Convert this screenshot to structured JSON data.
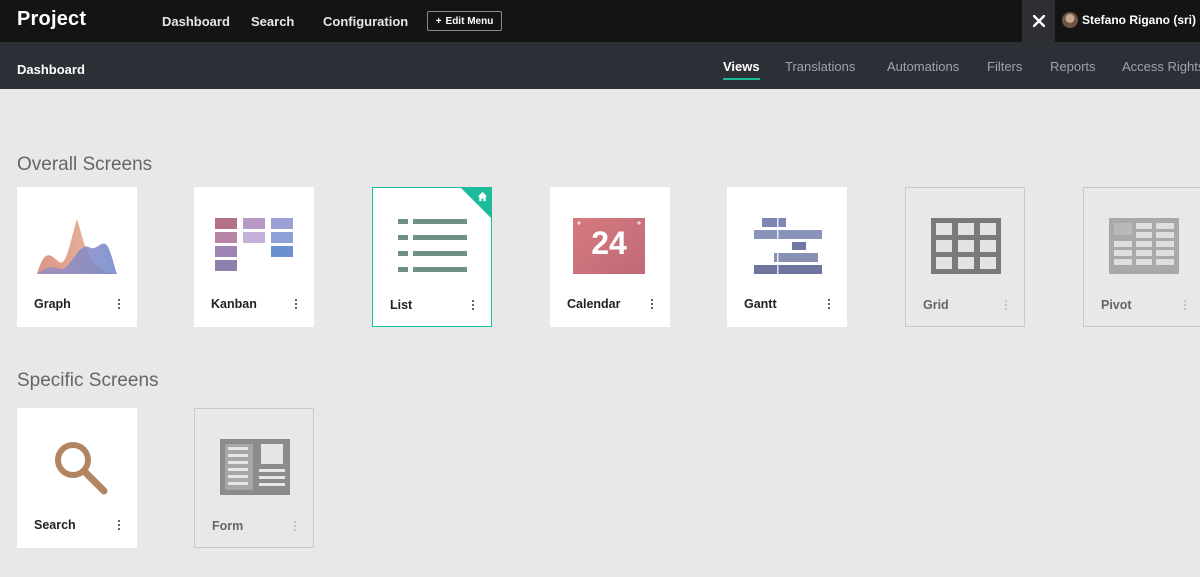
{
  "app": {
    "brand": "Project",
    "nav": [
      "Dashboard",
      "Search",
      "Configuration"
    ],
    "edit_menu": "Edit Menu",
    "user_name": "Stefano Rigano (sri)"
  },
  "subnav": {
    "title": "Dashboard",
    "tabs": [
      {
        "label": "Views",
        "active": true
      },
      {
        "label": "Translations",
        "active": false
      },
      {
        "label": "Automations",
        "active": false
      },
      {
        "label": "Filters",
        "active": false
      },
      {
        "label": "Reports",
        "active": false
      },
      {
        "label": "Access Rights",
        "active": false
      }
    ]
  },
  "sections": {
    "overall_title": "Overall Screens",
    "specific_title": "Specific Screens"
  },
  "overall_cards": [
    {
      "label": "Graph",
      "icon": "graph-icon",
      "enabled": true,
      "selected": false
    },
    {
      "label": "Kanban",
      "icon": "kanban-icon",
      "enabled": true,
      "selected": false
    },
    {
      "label": "List",
      "icon": "list-icon",
      "enabled": true,
      "selected": true,
      "default_icon": "home-icon"
    },
    {
      "label": "Calendar",
      "icon": "calendar-icon",
      "enabled": true,
      "selected": false,
      "icon_text": "24"
    },
    {
      "label": "Gantt",
      "icon": "gantt-icon",
      "enabled": true,
      "selected": false
    },
    {
      "label": "Grid",
      "icon": "grid-icon",
      "enabled": false,
      "selected": false
    },
    {
      "label": "Pivot",
      "icon": "pivot-icon",
      "enabled": false,
      "selected": false
    }
  ],
  "specific_cards": [
    {
      "label": "Search",
      "icon": "search-icon",
      "enabled": true,
      "selected": false
    },
    {
      "label": "Form",
      "icon": "form-icon",
      "enabled": false,
      "selected": false
    }
  ],
  "colors": {
    "accent": "#1abc9c",
    "topbar": "#141414",
    "subbar": "#2c2f36",
    "background": "#e8e8e8"
  }
}
